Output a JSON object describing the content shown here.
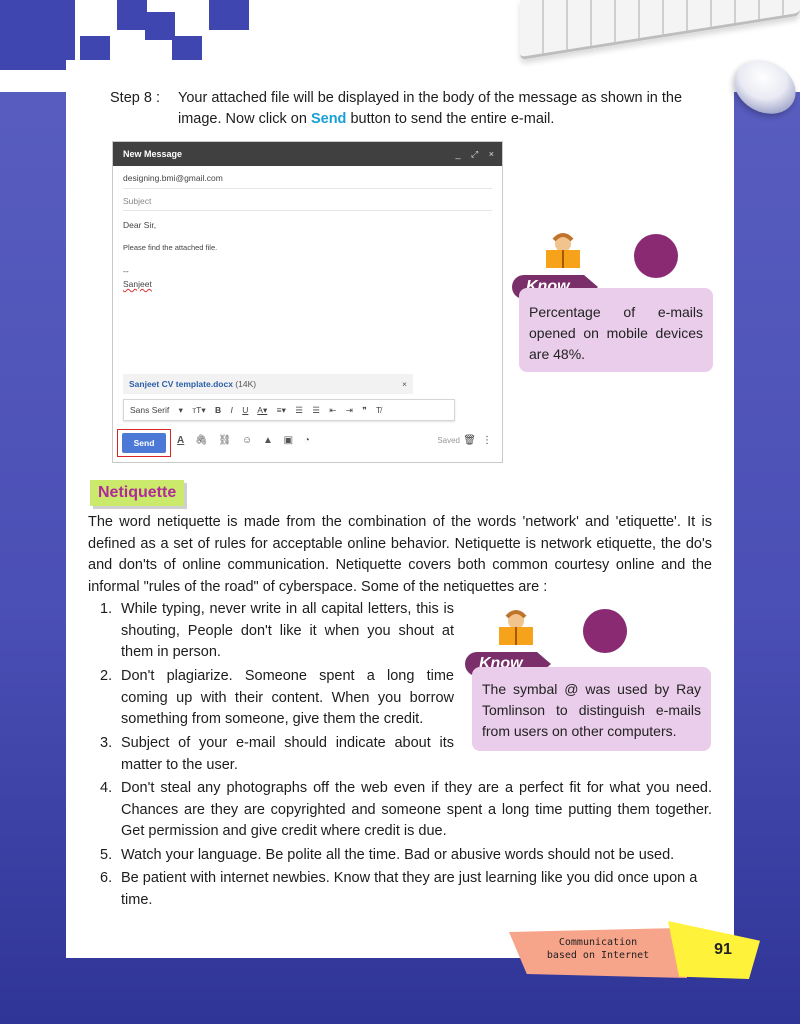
{
  "step": {
    "label": "Step 8 :",
    "text_before": "Your attached file will be displayed in the body of the message as shown in the image. Now click on ",
    "highlight": "Send",
    "text_after": " button to send the entire e-mail."
  },
  "compose": {
    "title": "New Message",
    "head_icons": [
      "_",
      "⤢",
      "×"
    ],
    "to": "designing.bmi@gmail.com",
    "subject_placeholder": "Subject",
    "body_line1": "Dear Sir,",
    "body_line2": "Please find the attached file.",
    "signature_sep": "--",
    "signature": "Sanjeet",
    "attachment_name": "Sanjeet CV template.docx",
    "attachment_size": "(14K)",
    "attachment_close": "×",
    "font_select": "Sans Serif",
    "send_label": "Send",
    "saved_label": "Saved"
  },
  "know_it_1": {
    "tag": "Know it",
    "text": "Percentage of e-mails opened on mobile devices are 48%."
  },
  "know_it_2": {
    "tag": "Know it",
    "text": "The symbal @ was used by Ray Tomlinson to distinguish e-mails from users on other computers."
  },
  "netiquette": {
    "title": "Netiquette",
    "intro": "The word netiquette is made from the combination of the words 'network' and 'etiquette'. It is defined as a set of rules for acceptable online behavior. Netiquette is network etiquette, the do's and don'ts of online communication. Netiquette covers both common courtesy online and the informal \"rules of the road\" of cyberspace. Some of the netiquettes are :",
    "items": [
      {
        "n": "1.",
        "text": "While typing, never write in all capital letters, this is shouting, People don't like it when you shout at them in person."
      },
      {
        "n": "2.",
        "text": "Don't plagiarize. Someone spent a long time coming up with their content. When you borrow something from someone, give them the credit."
      },
      {
        "n": "3.",
        "text": "Subject of your e-mail should indicate about its matter to the user."
      },
      {
        "n": "4.",
        "text": "Don't steal any photographs off the web even if they are a perfect fit for what you need. Chances are they are copyrighted and someone spent a long time putting them together. Get permission and give credit where credit is due."
      },
      {
        "n": "5.",
        "text": "Watch your language. Be polite all the time. Bad or abusive words should not be used."
      },
      {
        "n": "6.",
        "text": "Be patient with internet newbies. Know that they are just learning like you did once upon a time."
      }
    ]
  },
  "footer": {
    "chapter_line1": "Communication",
    "chapter_line2": "based on Internet",
    "page_number": "91"
  },
  "colors": {
    "background": "#4a4fb5",
    "know_box": "#eacdea",
    "know_tag": "#7a2f6a",
    "netiquette_bg": "#cbe96a",
    "netiquette_text": "#b02a9a",
    "send_button": "#4d79d6",
    "highlight": "#19a0d8"
  }
}
